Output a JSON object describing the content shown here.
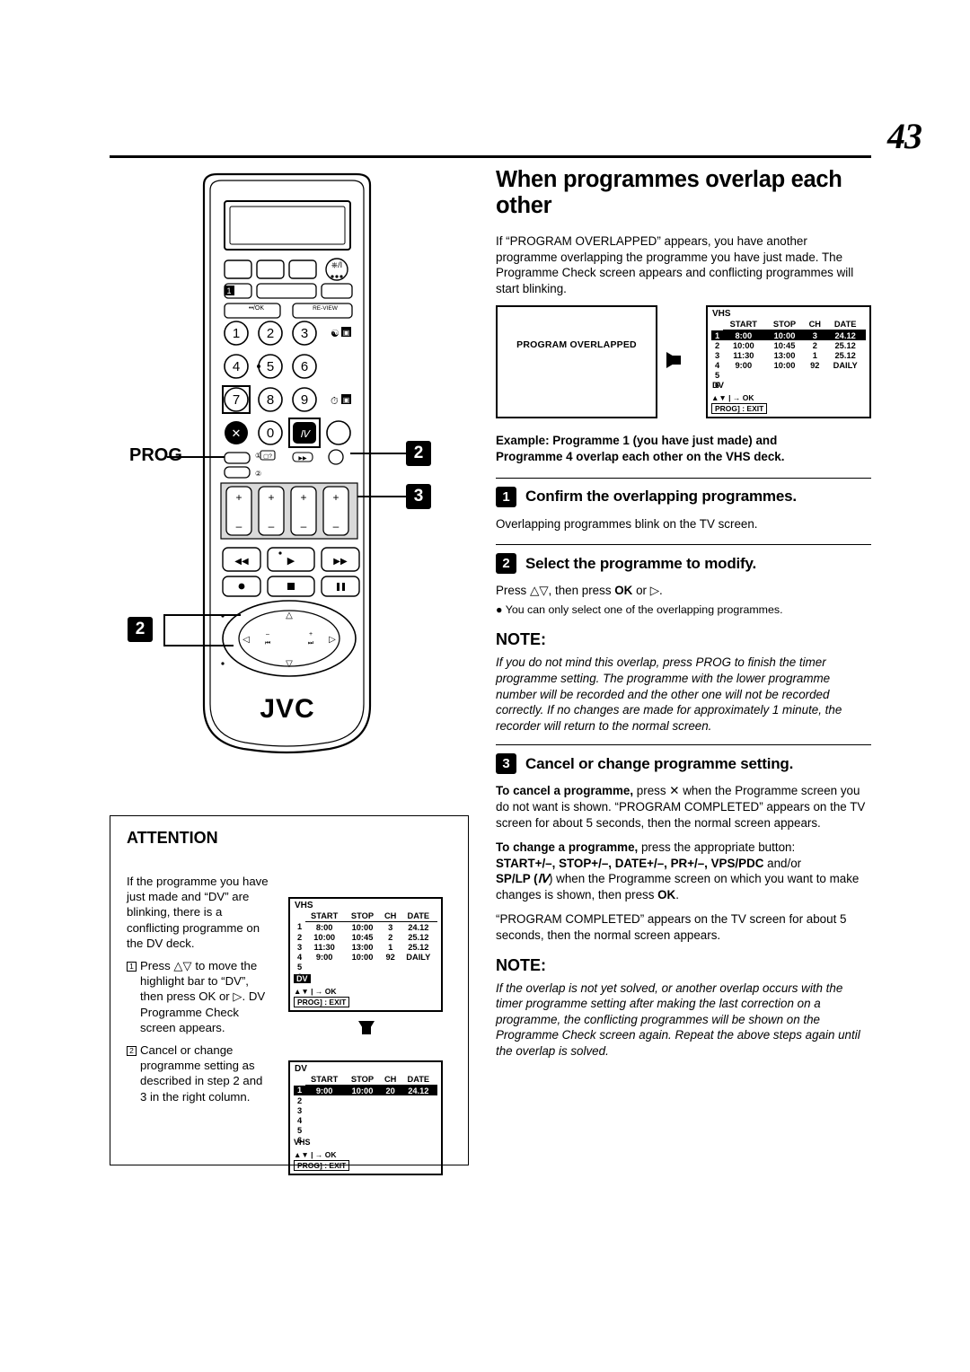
{
  "page": {
    "number": "43"
  },
  "main": {
    "title": "When programmes overlap each other",
    "intro": "If “PROGRAM OVERLAPPED” appears, you have another programme overlapping the programme you have just made. The Programme Check screen appears and conflicting programmes will start blinking.",
    "osd_message": "PROGRAM OVERLAPPED",
    "example_line1": "Example: Programme 1 (you have just made) and",
    "example_line2": "Programme 4 overlap each other on the VHS deck.",
    "steps": [
      {
        "num": "1",
        "title": "Confirm the overlapping programmes.",
        "body": "Overlapping programmes blink on the TV screen."
      },
      {
        "num": "2",
        "title": "Select the programme to modify.",
        "body_pre": "Press ",
        "body_keys": "△▽, then press ",
        "ok": "OK",
        "body_post": " or ▷.",
        "bullet": "● You can only select one of the overlapping programmes."
      },
      {
        "num": "3",
        "title": "Cancel or change programme setting."
      }
    ],
    "note1_heading": "NOTE:",
    "note1_text": "If you do not mind this overlap, press PROG to finish the timer programme setting. The programme with the lower programme number will be recorded and the other one will not be recorded correctly. If no changes are made for approximately 1 minute, the recorder will return to the normal screen.",
    "note1_bold": "PROG",
    "step3_p1_bold": "To cancel a programme,",
    "step3_p1_rest": " press ✕ when the Programme screen you do not want is shown. “PROGRAM COMPLETED” appears on the TV screen for about 5 seconds, then the normal screen appears.",
    "step3_p2_bold": "To change a programme,",
    "step3_p2_rest": " press the appropriate button:",
    "step3_p3_bold": "START+/–, STOP+/–, DATE+/–, PR+/–, VPS/PDC",
    "step3_p3_rest": " and/or",
    "step3_p4_bold": "SP/LP (",
    "step3_p4_rest": ") when the Programme screen on which you want to make changes is shown, then press ",
    "step3_p4_ok": "OK",
    "step3_p4_end": ".",
    "step3_p5": "“PROGRAM COMPLETED” appears on the TV screen for about 5 seconds, then the normal screen appears.",
    "note2_heading": "NOTE:",
    "note2_text": "If the overlap is not yet solved, or another overlap occurs with the timer programme setting after making the last correction on a programme, the conflicting programmes will be shown on the Programme Check screen again. Repeat the above steps again until the overlap is solved."
  },
  "osd": {
    "headers": [
      "START",
      "STOP",
      "CH",
      "DATE"
    ],
    "vhs_label": "VHS",
    "dv_label": "DV",
    "prog_exit": "PROG] : EXIT",
    "nav_hint": "▲▼ | → OK",
    "vhs_rows": [
      {
        "num": "1",
        "start": "8:00",
        "stop": "10:00",
        "ch": "3",
        "date": "24.12",
        "hl": true
      },
      {
        "num": "2",
        "start": "10:00",
        "stop": "10:45",
        "ch": "2",
        "date": "25.12",
        "hl": false
      },
      {
        "num": "3",
        "start": "11:30",
        "stop": "13:00",
        "ch": "1",
        "date": "25.12",
        "hl": false
      },
      {
        "num": "4",
        "start": "9:00",
        "stop": "10:00",
        "ch": "92",
        "date": "DAILY",
        "hl": false
      },
      {
        "num": "5",
        "start": "",
        "stop": "",
        "ch": "",
        "date": "",
        "hl": false
      },
      {
        "num": "6",
        "start": "",
        "stop": "",
        "ch": "",
        "date": "",
        "hl": false
      }
    ],
    "dv_rows": [
      {
        "num": "1",
        "start": "9:00",
        "stop": "10:00",
        "ch": "20",
        "date": "24.12",
        "hl": true
      },
      {
        "num": "2",
        "start": "",
        "stop": "",
        "ch": "",
        "date": "",
        "hl": false
      },
      {
        "num": "3",
        "start": "",
        "stop": "",
        "ch": "",
        "date": "",
        "hl": false
      },
      {
        "num": "4",
        "start": "",
        "stop": "",
        "ch": "",
        "date": "",
        "hl": false
      },
      {
        "num": "5",
        "start": "",
        "stop": "",
        "ch": "",
        "date": "",
        "hl": false
      },
      {
        "num": "6",
        "start": "",
        "stop": "",
        "ch": "",
        "date": "",
        "hl": false
      }
    ]
  },
  "attention": {
    "heading": "ATTENTION",
    "intro": "If the programme you have just made and “DV” are blinking, there is a conflicting programme on the DV deck.",
    "step1_num": "1",
    "step1_text": "Press △▽ to move the highlight bar to “DV”, then press OK or ▷. DV Programme Check screen appears.",
    "step2_num": "2",
    "step2_text": "Cancel or change programme setting as described in step 2 and 3 in the right column."
  },
  "remote": {
    "brand": "JVC",
    "prog_label": "PROG",
    "callout2": "2",
    "callout3": "3",
    "callout2b": "2",
    "keys": [
      "1",
      "2",
      "3",
      "4",
      "5",
      "6",
      "7",
      "8",
      "9",
      "0"
    ],
    "review_label": "RE-VIEW"
  }
}
